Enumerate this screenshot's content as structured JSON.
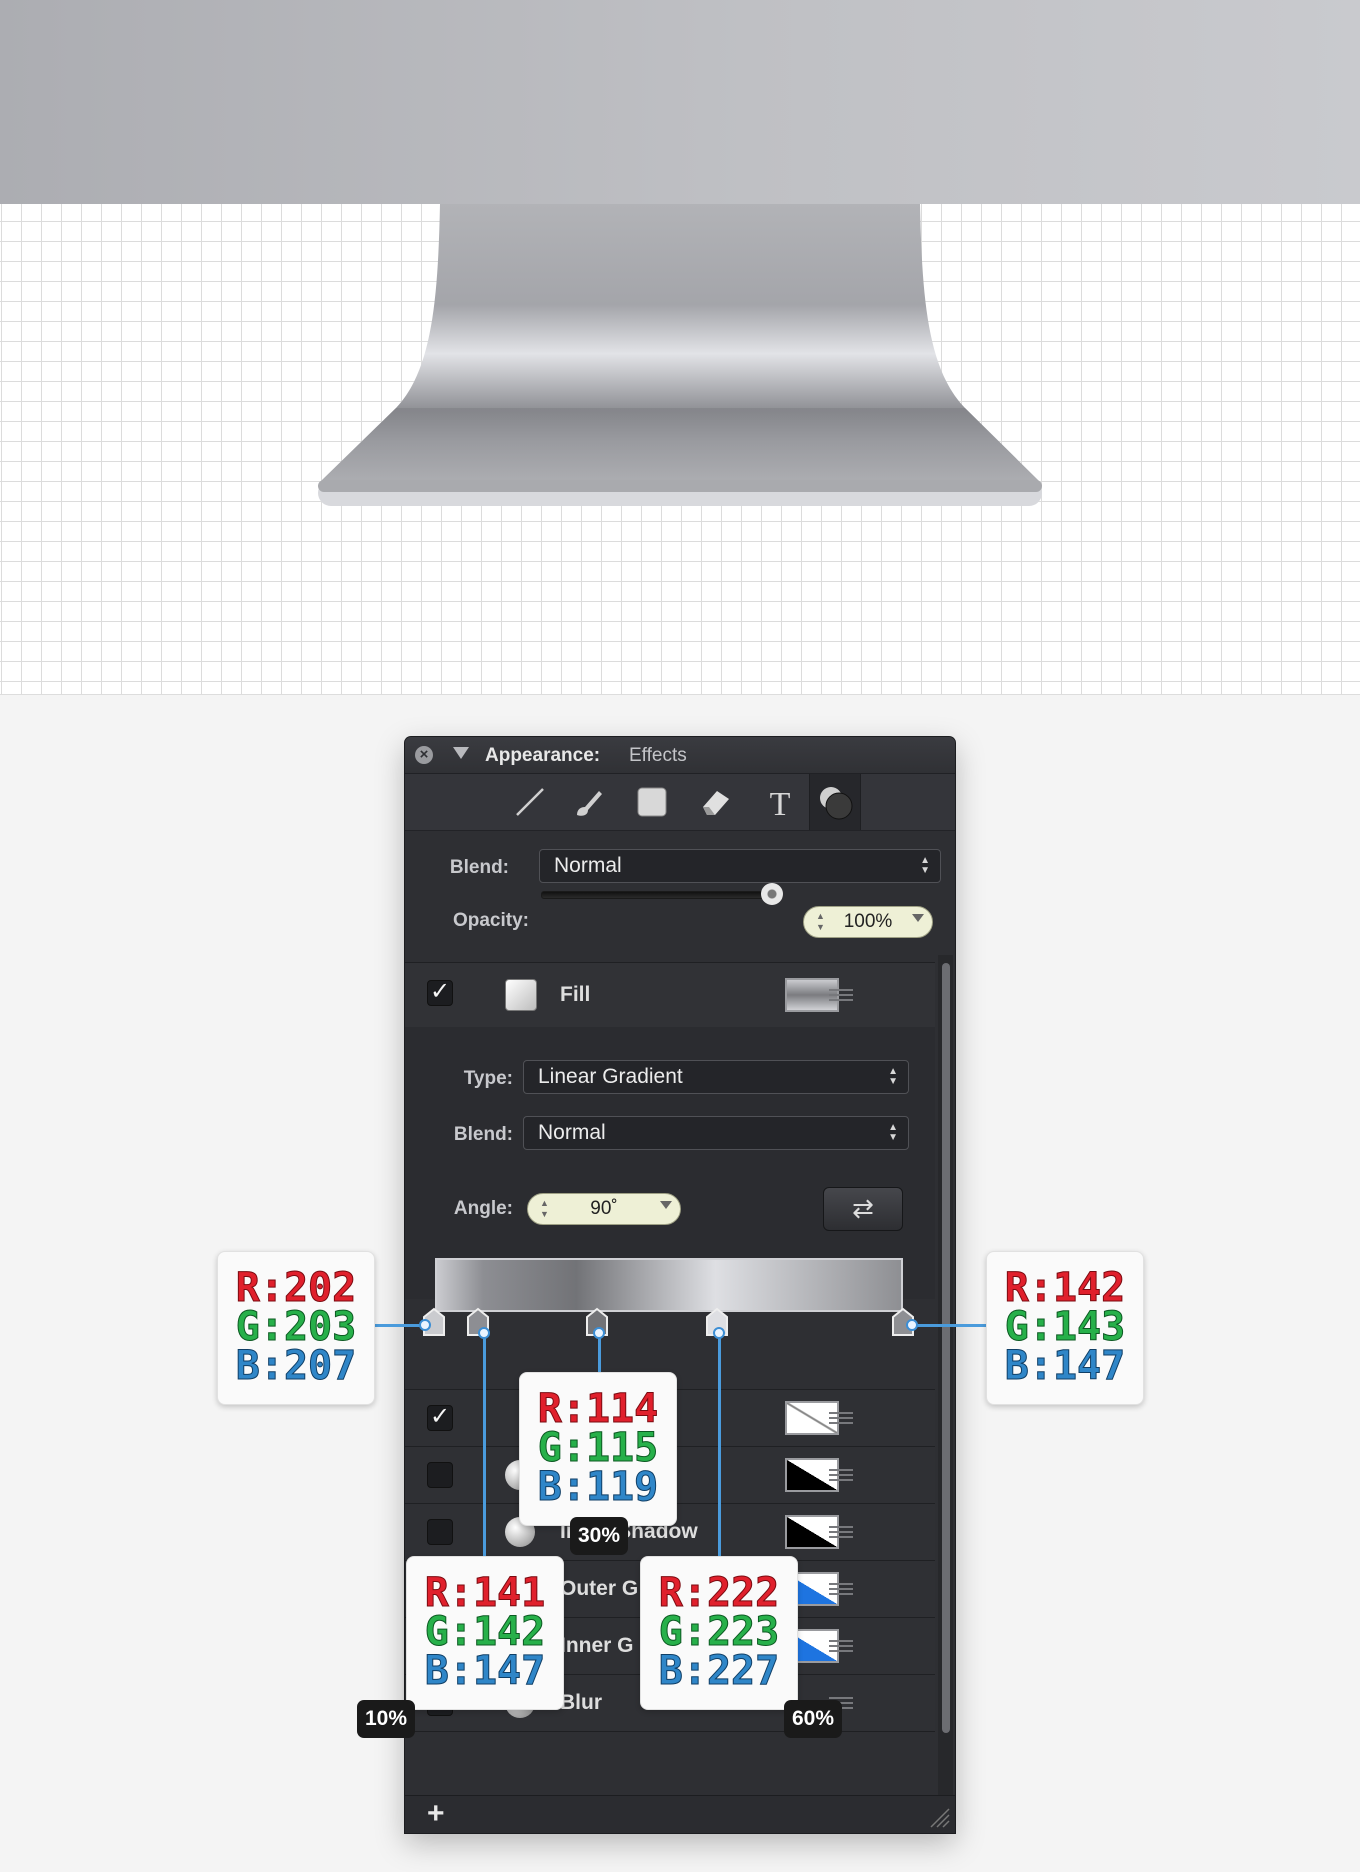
{
  "panel": {
    "title_label": "Appearance:",
    "title_value": "Effects",
    "tools": [
      "line-tool-icon",
      "brush-tool-icon",
      "fill-tool-icon",
      "eraser-tool-icon",
      "text-tool-icon",
      "effects-tool-icon"
    ],
    "blend_label": "Blend:",
    "blend_value": "Normal",
    "opacity_label": "Opacity:",
    "opacity_value": "100%",
    "opacity_level": 1.0,
    "fill_row_label": "Fill",
    "type_label": "Type:",
    "type_value": "Linear Gradient",
    "fill_blend_label": "Blend:",
    "fill_blend_value": "Normal",
    "angle_label": "Angle:",
    "angle_value": "90˚",
    "effects_rows": [
      {
        "label": "",
        "checked": true
      },
      {
        "label": "ow",
        "checked": false
      },
      {
        "label": "Inner Shadow",
        "checked": false
      },
      {
        "label": "Outer G",
        "checked": false
      },
      {
        "label": "Inner G",
        "checked": false
      },
      {
        "label": "Blur",
        "checked": false
      }
    ],
    "add_label": "+"
  },
  "gradient_stops": [
    {
      "r": "R:202",
      "g": "G:203",
      "b": "B:207",
      "position": "0%"
    },
    {
      "r": "R:141",
      "g": "G:142",
      "b": "B:147",
      "position": "10%"
    },
    {
      "r": "R:114",
      "g": "G:115",
      "b": "B:119",
      "position": "30%"
    },
    {
      "r": "R:222",
      "g": "G:223",
      "b": "B:227",
      "position": "60%"
    },
    {
      "r": "R:142",
      "g": "G:143",
      "b": "B:147",
      "position": "100%"
    }
  ],
  "badges": {
    "stop_10": "10%",
    "stop_30": "30%",
    "stop_60": "60%"
  },
  "colors": {
    "panel_bg": "#2e2f33",
    "connector": "#4a9bdc",
    "red": "#e0202c",
    "green": "#27b04a",
    "blue": "#2f86c8"
  }
}
